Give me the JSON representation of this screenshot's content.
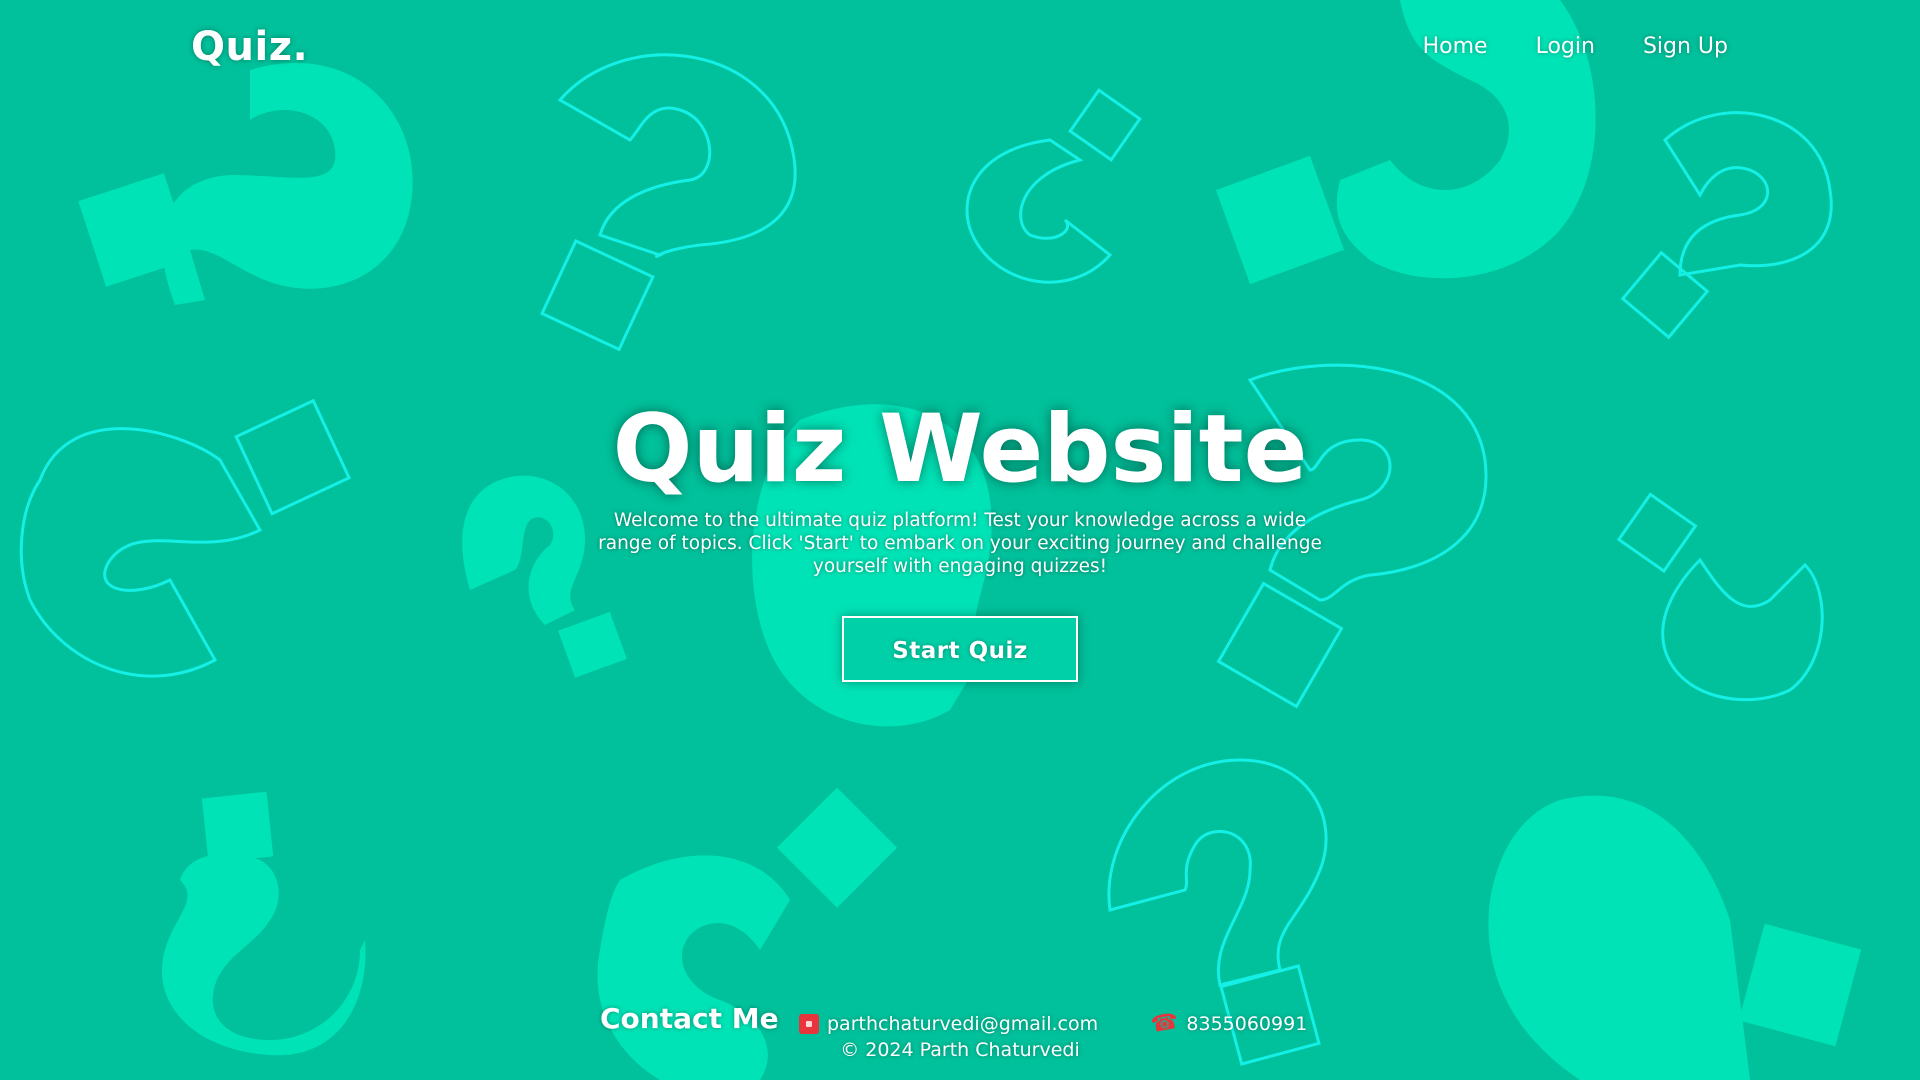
{
  "colors": {
    "background": "#00c19b",
    "shape_fill": "#00e3b6",
    "shape_outline": "#14f0e6",
    "text": "#ffffff",
    "icon_accent": "#e8343b"
  },
  "navbar": {
    "logo": "Quiz.",
    "links": [
      {
        "label": "Home"
      },
      {
        "label": "Login"
      },
      {
        "label": "Sign Up"
      }
    ]
  },
  "hero": {
    "title": "Quiz Website",
    "description": "Welcome to the ultimate quiz platform! Test your knowledge across a wide range of topics. Click 'Start' to embark on your exciting journey and challenge yourself with engaging quizzes!",
    "button_label": "Start Quiz"
  },
  "footer": {
    "contact_title": "Contact Me",
    "email": "parthchaturvedi@gmail.com",
    "email_icon": "mail-icon",
    "phone": "8355060991",
    "phone_icon": "phone-icon",
    "copyright": "© 2024 Parth Chaturvedi"
  }
}
